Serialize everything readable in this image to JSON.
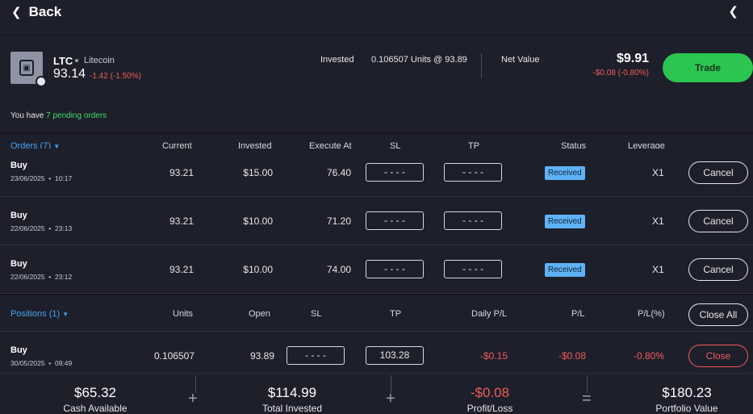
{
  "topbar": {
    "back_label": "Back",
    "back_icon": "chevron-left-icon",
    "collapse_icon": "chevron-left-icon"
  },
  "asset": {
    "symbol": "LTC",
    "name": "Litecoin",
    "price": "93.14",
    "change": "-1.42 (-1.50%)",
    "invested_label": "Invested",
    "invested_value": "0.106507 Units @ 93.89",
    "net_value_label": "Net Value",
    "net_value": "$9.91",
    "net_value_change": "-$0.08 (-0.80%)",
    "trade_label": "Trade"
  },
  "pending": {
    "prefix": "You have ",
    "highlight": "7 pending orders"
  },
  "orders": {
    "headers": {
      "title": "Orders (7)",
      "current": "Current",
      "invested": "Invested",
      "execute_at": "Execute At",
      "sl": "SL",
      "tp": "TP",
      "status": "Status",
      "leverage": "Leverage"
    },
    "rows": [
      {
        "side": "Buy",
        "date": "23/06/2025",
        "time": "10:17",
        "current": "93.21",
        "invested": "$15.00",
        "execute_at": "76.40",
        "sl": "- - - -",
        "tp": "- - - -",
        "status": "Received",
        "leverage": "X1",
        "action": "Cancel"
      },
      {
        "side": "Buy",
        "date": "22/06/2025",
        "time": "23:13",
        "current": "93.21",
        "invested": "$10.00",
        "execute_at": "71.20",
        "sl": "- - - -",
        "tp": "- - - -",
        "status": "Received",
        "leverage": "X1",
        "action": "Cancel"
      },
      {
        "side": "Buy",
        "date": "22/06/2025",
        "time": "23:12",
        "current": "93.21",
        "invested": "$10.00",
        "execute_at": "74.00",
        "sl": "- - - -",
        "tp": "- - - -",
        "status": "Received",
        "leverage": "X1",
        "action": "Cancel"
      }
    ]
  },
  "positions": {
    "headers": {
      "title": "Positions (1)",
      "units": "Units",
      "open": "Open",
      "sl": "SL",
      "tp": "TP",
      "daily_pl": "Daily P/L",
      "pl": "P/L",
      "pl_pct": "P/L(%)",
      "close_all": "Close All"
    },
    "rows": [
      {
        "side": "Buy",
        "date": "30/05/2025",
        "time": "09:49",
        "units": "0.106507",
        "open": "93.89",
        "sl": "- - - -",
        "tp": "103.28",
        "daily_pl": "-$0.15",
        "pl": "-$0.08",
        "pl_pct": "-0.80%",
        "action": "Close"
      }
    ]
  },
  "footer": {
    "cash_value": "$65.32",
    "cash_label": "Cash Available",
    "op1": "+",
    "invested_value": "$114.99",
    "invested_label": "Total Invested",
    "op2": "+",
    "pl_value": "-$0.08",
    "pl_label": "Profit/Loss",
    "op3": "=",
    "portfolio_value": "$180.23",
    "portfolio_label": "Portfolio Value"
  },
  "colors": {
    "accent_green": "#2cc551",
    "accent_blue": "#4aa3f0",
    "negative_red": "#f25b5b",
    "background": "#1d1f2b"
  }
}
